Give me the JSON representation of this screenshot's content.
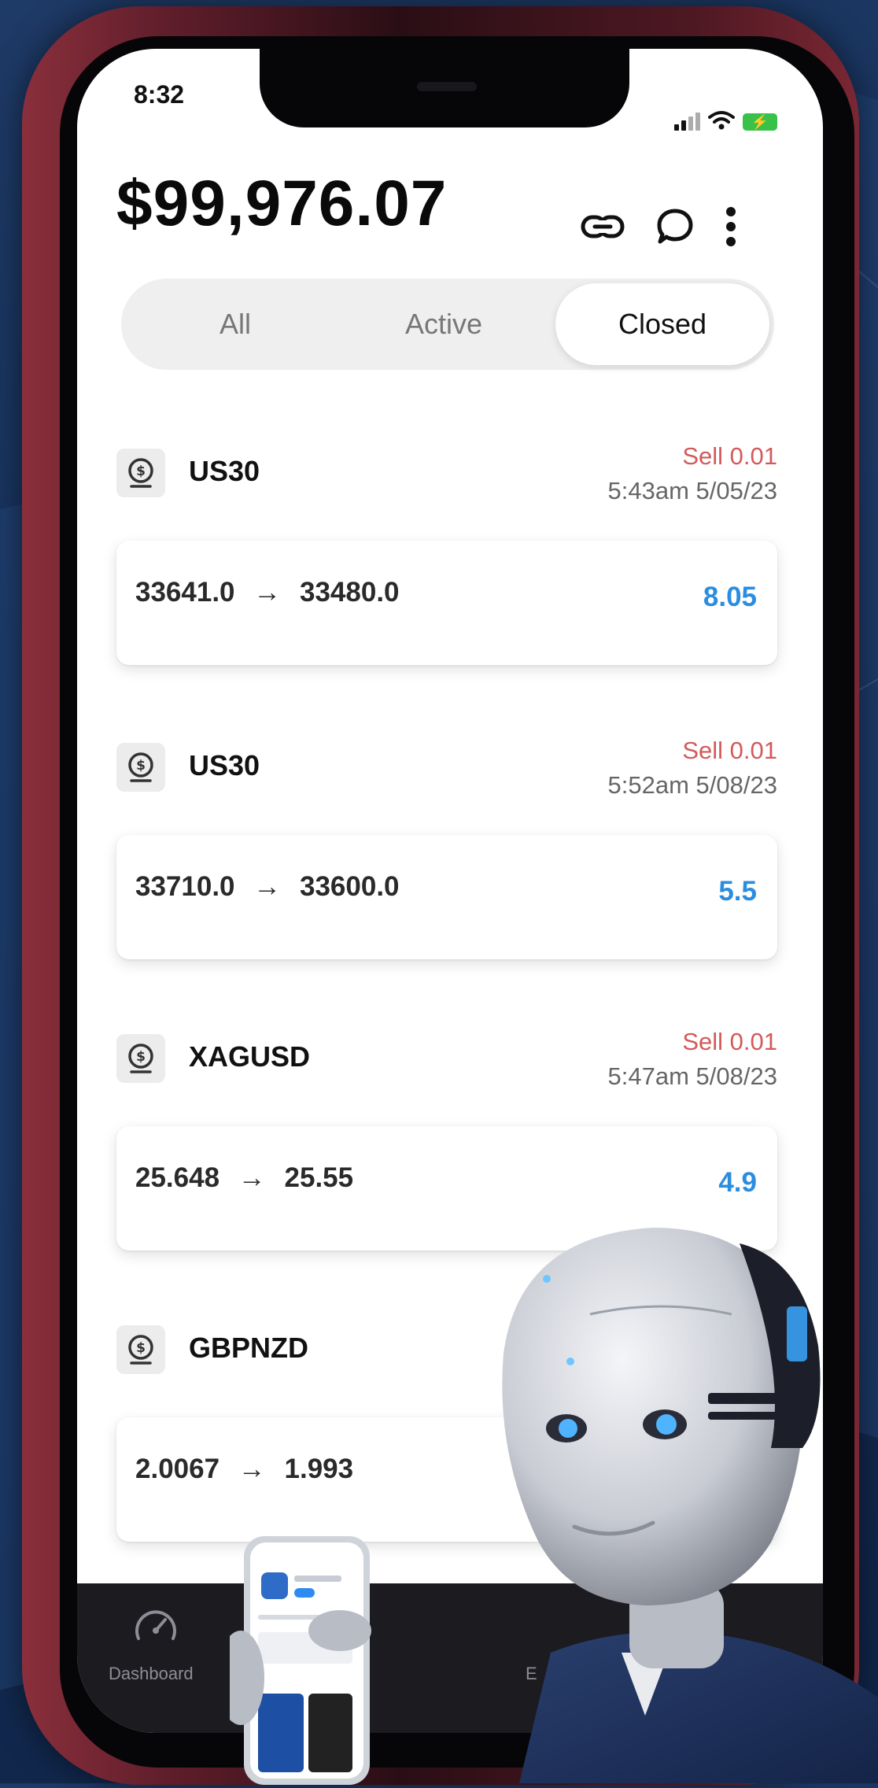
{
  "status": {
    "time": "8:32",
    "battery_glyph": "⚡"
  },
  "header": {
    "balance": "$99,976.07",
    "icons": [
      "link-icon",
      "chat-icon",
      "more-vertical-icon"
    ]
  },
  "tabs": [
    {
      "label": "All",
      "active": false
    },
    {
      "label": "Active",
      "active": false
    },
    {
      "label": "Closed",
      "active": true
    }
  ],
  "trades": [
    {
      "symbol": "US30",
      "side": "Sell 0.01",
      "time": "5:43am 5/05/23",
      "open": "33641.0",
      "close": "33480.0",
      "arrow": "→",
      "pnl": "8.05"
    },
    {
      "symbol": "US30",
      "side": "Sell 0.01",
      "time": "5:52am 5/08/23",
      "open": "33710.0",
      "close": "33600.0",
      "arrow": "→",
      "pnl": "5.5"
    },
    {
      "symbol": "XAGUSD",
      "side": "Sell 0.01",
      "time": "5:47am 5/08/23",
      "open": "25.648",
      "close": "25.55",
      "arrow": "→",
      "pnl": "4.9"
    },
    {
      "symbol": "GBPNZD",
      "side": "",
      "time": "",
      "open": "2.0067",
      "close": "1.993",
      "arrow": "→",
      "pnl": ""
    }
  ],
  "tabbar": {
    "dashboard_label": "Dashboard",
    "second_label_fragment": "E"
  },
  "colors": {
    "sell": "#d35a5a",
    "profit": "#2b8de0",
    "phone_frame": "#5e1d2a",
    "background": "#16305a"
  }
}
